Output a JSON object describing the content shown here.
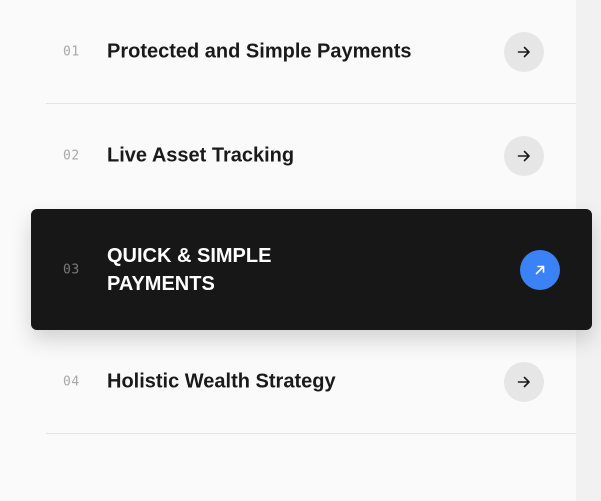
{
  "items": [
    {
      "number": "01",
      "title": "Protected and Simple Payments"
    },
    {
      "number": "02",
      "title": "Live Asset Tracking"
    },
    {
      "number": "03",
      "title": "QUICK & SIMPLE PAYMENTS"
    },
    {
      "number": "04",
      "title": "Holistic Wealth Strategy"
    }
  ],
  "active_index": 2,
  "icons": {
    "default_arrow": "arrow-right-icon",
    "active_arrow": "arrow-up-right-icon"
  },
  "colors": {
    "background": "#fafafa",
    "active_card": "#171717",
    "accent": "#3b82f6",
    "button_bg": "#e6e6e6",
    "divider": "#e4e4e4"
  }
}
